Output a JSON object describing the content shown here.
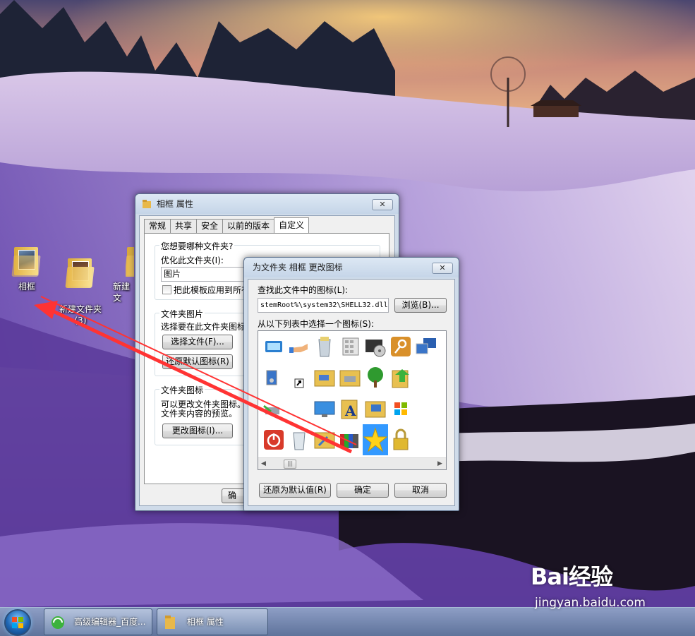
{
  "desktop": {
    "icons": [
      {
        "label": "相框",
        "icon": "folder-photo-icon"
      },
      {
        "label": "新建文件夹\n(3)",
        "icon": "folder-icon"
      },
      {
        "label": "新建文",
        "icon": "folder-icon"
      }
    ]
  },
  "properties_window": {
    "title": "相框 属性",
    "close_label": "✕",
    "tabs": [
      "常规",
      "共享",
      "安全",
      "以前的版本",
      "自定义"
    ],
    "active_tab": "自定义",
    "group1_title": "您想要哪种文件夹?",
    "optimize_label": "优化此文件夹(I):",
    "optimize_value": "图片",
    "apply_template_label": "把此模板应用到所有",
    "group2_title": "文件夹图片",
    "choose_label": "选择要在此文件夹图标",
    "choose_file_btn": "选择文件(F)...",
    "restore_default_btn": "还原默认图标(R)",
    "group3_title": "文件夹图标",
    "change_desc_line1": "可以更改文件夹图标。",
    "change_desc_line2": "文件夹内容的预览。",
    "change_icon_btn": "更改图标(I)...",
    "ok_btn_partial": "确"
  },
  "change_icon_dialog": {
    "title": "为文件夹 相框 更改图标",
    "close_label": "✕",
    "find_label": "查找此文件中的图标(L):",
    "file_path": "stemRoot%\\system32\\SHELL32.dll",
    "browse_btn": "浏览(B)...",
    "choose_label": "从以下列表中选择一个图标(S):",
    "icons": [
      "monitor-window-icon",
      "hand-share-icon",
      "recycle-bin-full-icon",
      "calculator-keypad-icon",
      "media-player-icon",
      "key-icon",
      "network-computers-icon",
      "computer-speaker-icon",
      "shortcut-arrow-icon",
      "folder-network-icon",
      "folder-drive-icon",
      "tree-icon",
      "folder-green-arrow-icon",
      "drive-icon",
      "blank-icon",
      "desktop-screen-icon",
      "fonts-folder-icon",
      "folder-computer-icon",
      "windows-logo-icon",
      "power-icon",
      "recycle-bin-empty-icon",
      "folder-tools-icon",
      "color-bars-icon",
      "star-icon",
      "lock-icon"
    ],
    "selected_icon": "star-icon",
    "restore_btn": "还原为默认值(R)",
    "ok_btn": "确定",
    "cancel_btn": "取消"
  },
  "taskbar": {
    "items": [
      {
        "label": "高级编辑器_百度...",
        "icon": "browser-icon"
      },
      {
        "label": "相框 属性",
        "icon": "folder-icon"
      }
    ]
  },
  "watermark": {
    "logo_text": "Bai经验",
    "url": "jingyan.baidu.com"
  },
  "colors": {
    "selection": "#3399ff",
    "annotation_arrow": "#ff3333"
  }
}
